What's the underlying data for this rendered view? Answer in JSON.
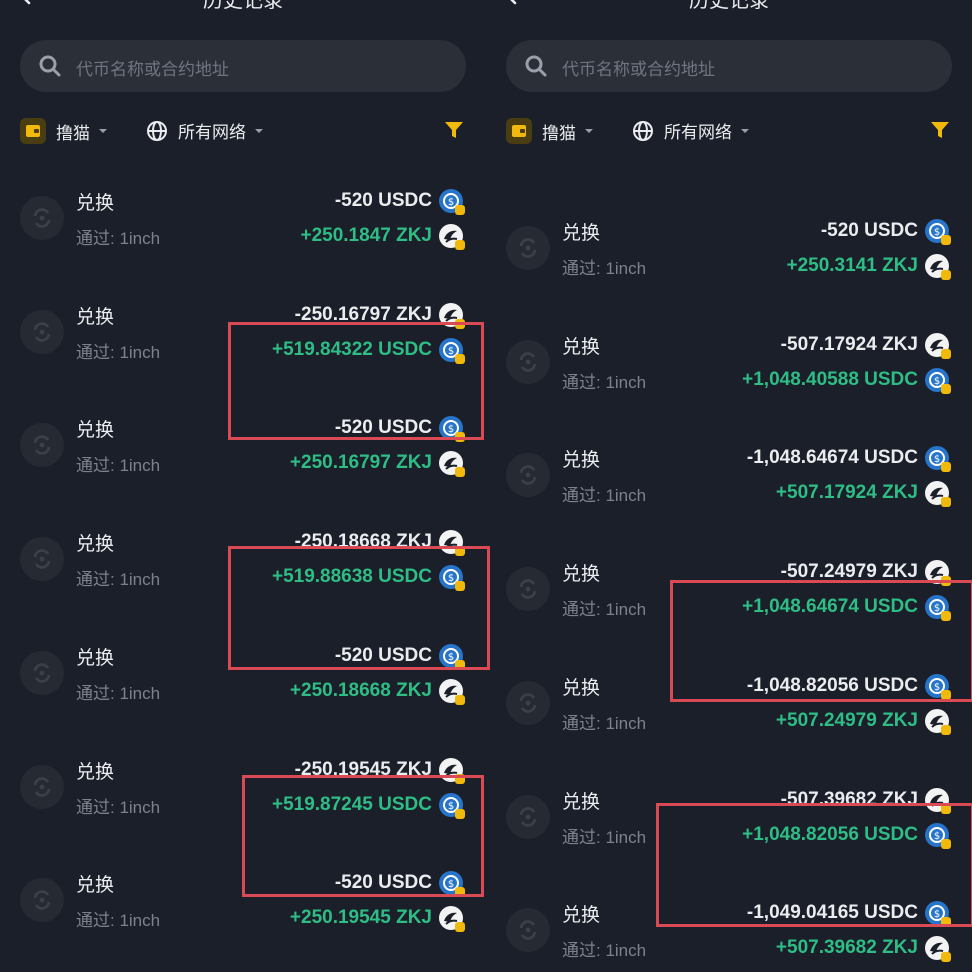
{
  "colors": {
    "background": "#1b1f29",
    "positive": "#2ebd85",
    "negative_text": "#eaecef",
    "accent": "#f0b90b",
    "highlight_box": "#d94a55"
  },
  "left": {
    "title": "历史记录",
    "search_placeholder": "代币名称或合约地址",
    "wallet_label": "撸猫",
    "network_label": "所有网络",
    "transactions": [
      {
        "type": "兑换",
        "via": "通过: 1inch",
        "out": "-520 USDC",
        "in": "+250.1847 ZKJ",
        "out_token": "usdc-icon",
        "in_token": "zkj-icon"
      },
      {
        "type": "兑换",
        "via": "通过: 1inch",
        "out": "-250.16797 ZKJ",
        "in": "+519.84322 USDC",
        "out_token": "zkj-icon",
        "in_token": "usdc-icon"
      },
      {
        "type": "兑换",
        "via": "通过: 1inch",
        "out": "-520 USDC",
        "in": "+250.16797 ZKJ",
        "out_token": "usdc-icon",
        "in_token": "zkj-icon"
      },
      {
        "type": "兑换",
        "via": "通过: 1inch",
        "out": "-250.18668 ZKJ",
        "in": "+519.88638 USDC",
        "out_token": "zkj-icon",
        "in_token": "usdc-icon"
      },
      {
        "type": "兑换",
        "via": "通过: 1inch",
        "out": "-520 USDC",
        "in": "+250.18668 ZKJ",
        "out_token": "usdc-icon",
        "in_token": "zkj-icon"
      },
      {
        "type": "兑换",
        "via": "通过: 1inch",
        "out": "-250.19545 ZKJ",
        "in": "+519.87245 USDC",
        "out_token": "zkj-icon",
        "in_token": "usdc-icon"
      },
      {
        "type": "兑换",
        "via": "通过: 1inch",
        "out": "-520 USDC",
        "in": "+250.19545 ZKJ",
        "out_token": "usdc-icon",
        "in_token": "zkj-icon"
      }
    ]
  },
  "right": {
    "title": "历史记录",
    "search_placeholder": "代币名称或合约地址",
    "wallet_label": "撸猫",
    "network_label": "所有网络",
    "transactions": [
      {
        "type": "兑换",
        "via": "通过: 1inch",
        "out": "-520 USDC",
        "in": "+250.3141 ZKJ",
        "out_token": "usdc-icon",
        "in_token": "zkj-icon"
      },
      {
        "type": "兑换",
        "via": "通过: 1inch",
        "out": "-507.17924 ZKJ",
        "in": "+1,048.40588 USDC",
        "out_token": "zkj-icon",
        "in_token": "usdc-icon"
      },
      {
        "type": "兑换",
        "via": "通过: 1inch",
        "out": "-1,048.64674 USDC",
        "in": "+507.17924 ZKJ",
        "out_token": "usdc-icon",
        "in_token": "zkj-icon"
      },
      {
        "type": "兑换",
        "via": "通过: 1inch",
        "out": "-507.24979 ZKJ",
        "in": "+1,048.64674 USDC",
        "out_token": "zkj-icon",
        "in_token": "usdc-icon"
      },
      {
        "type": "兑换",
        "via": "通过: 1inch",
        "out": "-1,048.82056 USDC",
        "in": "+507.24979 ZKJ",
        "out_token": "usdc-icon",
        "in_token": "zkj-icon"
      },
      {
        "type": "兑换",
        "via": "通过: 1inch",
        "out": "-507.39682 ZKJ",
        "in": "+1,048.82056 USDC",
        "out_token": "zkj-icon",
        "in_token": "usdc-icon"
      },
      {
        "type": "兑换",
        "via": "通过: 1inch",
        "out": "-1,049.04165 USDC",
        "in": "+507.39682 ZKJ",
        "out_token": "usdc-icon",
        "in_token": "zkj-icon"
      }
    ]
  }
}
